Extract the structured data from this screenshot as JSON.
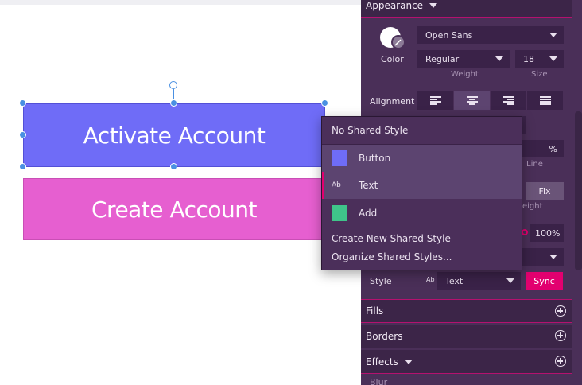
{
  "canvas": {
    "activate_label": "Activate Account",
    "create_label": "Create Account",
    "activate_color": "#6f6cf7",
    "create_color": "#e65fd0"
  },
  "inspector": {
    "appearance": "Appearance",
    "color_label": "Color",
    "font_family": "Open Sans",
    "font_weight": "Regular",
    "font_size": "18",
    "weight_label": "Weight",
    "size_label": "Size",
    "alignment_label": "Alignment",
    "alignment_options": [
      "left",
      "center",
      "right",
      "justify"
    ],
    "alignment_selected": "center",
    "percent_suffix": "%",
    "line_label": "Line",
    "fix_label": "Fix",
    "height_fragment": "eight",
    "opacity_value": "100%",
    "style_label": "Style",
    "style_ab": "Ab",
    "style_value": "Text",
    "sync_label": "Sync",
    "fills": "Fills",
    "borders": "Borders",
    "effects": "Effects",
    "blur": "Blur"
  },
  "popup": {
    "no_shared": "No Shared Style",
    "button_item": "Button",
    "text_ab": "Ab",
    "text_item": "Text",
    "add_item": "Add",
    "create_new": "Create New Shared Style",
    "organize": "Organize Shared Styles...",
    "button_swatch": "#6f6cf7",
    "add_swatch": "#3fc48a"
  },
  "colors": {
    "panel": "#4a2f58",
    "accent": "#e2006f",
    "selection": "#4a90e2"
  }
}
